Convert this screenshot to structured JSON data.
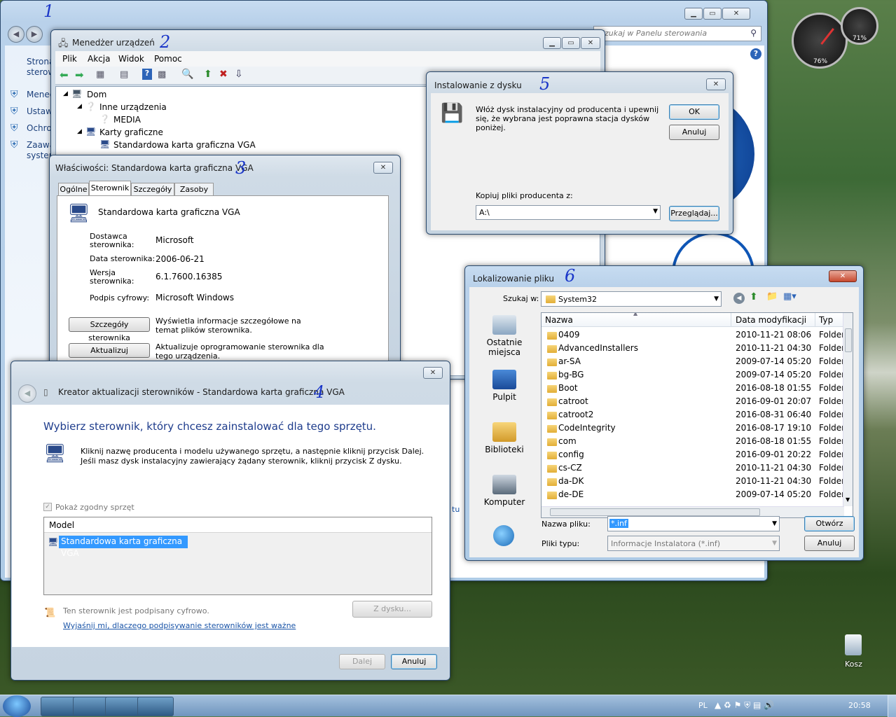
{
  "annotations": [
    "1",
    "2",
    "3",
    "4",
    "5",
    "6"
  ],
  "control_panel": {
    "search_placeholder": "Szukaj w Panelu sterowania",
    "left_items": [
      "Strona",
      "sterow",
      "Mened",
      "Ustawi",
      "Ochro",
      "Zaawa",
      "system"
    ],
    "link_tail": "tu"
  },
  "device_manager": {
    "title": "Menedżer urządzeń",
    "menu": [
      "Plik",
      "Akcja",
      "Widok",
      "Pomoc"
    ],
    "tree": [
      "Dom",
      "Inne urządzenia",
      "MEDIA",
      "Karty graficzne",
      "Standardowa karta graficzna VGA"
    ]
  },
  "properties": {
    "title": "Właściwości: Standardowa karta graficzna VGA",
    "tabs": [
      "Ogólne",
      "Sterownik",
      "Szczegóły",
      "Zasoby"
    ],
    "device_name": "Standardowa karta graficzna VGA",
    "fields": [
      {
        "label": "Dostawca sterownika:",
        "value": "Microsoft"
      },
      {
        "label": "Data sterownika:",
        "value": "2006-06-21"
      },
      {
        "label": "Wersja sterownika:",
        "value": "6.1.7600.16385"
      },
      {
        "label": "Podpis cyfrowy:",
        "value": "Microsoft Windows"
      }
    ],
    "details_button": "Szczegóły sterownika",
    "details_desc": "Wyświetla informacje szczegółowe na temat plików sterownika.",
    "update_button": "Aktualizuj sterownik...",
    "update_desc": "Aktualizuje oprogramowanie sterownika dla tego urządzenia."
  },
  "wizard": {
    "title": "Kreator aktualizacji sterowników - Standardowa karta graficzna VGA",
    "heading": "Wybierz sterownik, który chcesz zainstalować dla tego sprzętu.",
    "instruction": "Kliknij nazwę producenta i modelu używanego sprzętu, a następnie kliknij przycisk Dalej. Jeśli masz dysk instalacyjny zawierający żądany sterownik, kliknij przycisk Z dysku.",
    "checkbox": "Pokaż zgodny sprzęt",
    "list_header": "Model",
    "list_item": "Standardowa karta graficzna VGA",
    "signed": "Ten sterownik jest podpisany cyfrowo.",
    "have_disk": "Z dysku...",
    "link": "Wyjaśnij mi, dlaczego podpisywanie sterowników jest ważne",
    "next": "Dalej",
    "cancel": "Anuluj"
  },
  "install_disk": {
    "title": "Instalowanie z dysku",
    "message": "Włóż dysk instalacyjny od producenta i upewnij się, że wybrana jest poprawna stacja dysków poniżej.",
    "ok": "OK",
    "cancel": "Anuluj",
    "copy_label": "Kopiuj pliki producenta z:",
    "path": "A:\\",
    "browse": "Przeglądaj..."
  },
  "locate_file": {
    "title": "Lokalizowanie pliku",
    "look_in_label": "Szukaj w:",
    "look_in": "System32",
    "places": [
      "Ostatnie miejsca",
      "Pulpit",
      "Biblioteki",
      "Komputer"
    ],
    "columns": [
      "Nazwa",
      "Data modyfikacji",
      "Typ"
    ],
    "rows": [
      {
        "name": "0409",
        "date": "2010-11-21 08:06",
        "type": "Folder"
      },
      {
        "name": "AdvancedInstallers",
        "date": "2010-11-21 04:30",
        "type": "Folder"
      },
      {
        "name": "ar-SA",
        "date": "2009-07-14 05:20",
        "type": "Folder"
      },
      {
        "name": "bg-BG",
        "date": "2009-07-14 05:20",
        "type": "Folder"
      },
      {
        "name": "Boot",
        "date": "2016-08-18 01:55",
        "type": "Folder"
      },
      {
        "name": "catroot",
        "date": "2016-09-01 20:07",
        "type": "Folder"
      },
      {
        "name": "catroot2",
        "date": "2016-08-31 06:40",
        "type": "Folder"
      },
      {
        "name": "CodeIntegrity",
        "date": "2016-08-17 19:10",
        "type": "Folder"
      },
      {
        "name": "com",
        "date": "2016-08-18 01:55",
        "type": "Folder"
      },
      {
        "name": "config",
        "date": "2016-09-01 20:22",
        "type": "Folder"
      },
      {
        "name": "cs-CZ",
        "date": "2010-11-21 04:30",
        "type": "Folder"
      },
      {
        "name": "da-DK",
        "date": "2010-11-21 04:30",
        "type": "Folder"
      },
      {
        "name": "de-DE",
        "date": "2009-07-14 05:20",
        "type": "Folder"
      }
    ],
    "filename_label": "Nazwa pliku:",
    "filename": "*.inf",
    "filetype_label": "Pliki typu:",
    "filetype": "Informacje Instalatora (*.inf)",
    "open": "Otwórz",
    "cancel": "Anuluj"
  },
  "gadget": {
    "cpu": "76%",
    "ram": "71%"
  },
  "desktop": {
    "recycle_bin": "Kosz"
  },
  "taskbar": {
    "lang": "PL",
    "clock": "20:58"
  }
}
